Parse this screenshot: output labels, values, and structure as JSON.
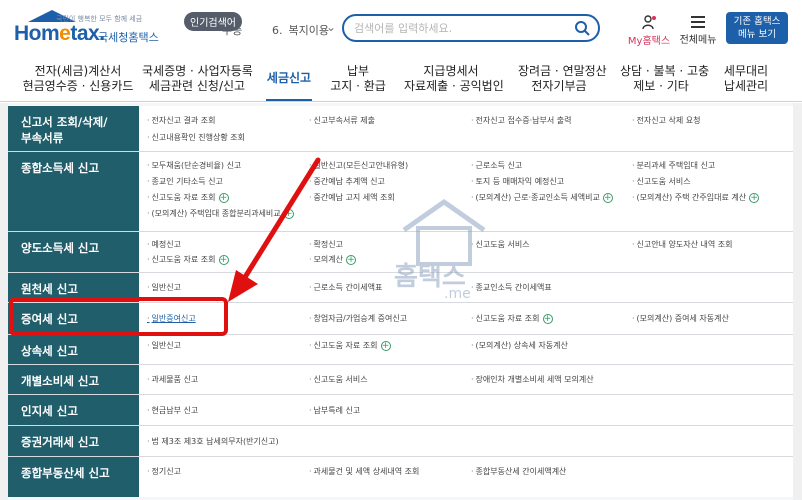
{
  "header": {
    "logo_slogan": "국민이 행복한 모두 함께 세금",
    "logo_brand_a": "Hom",
    "logo_brand_b": "e",
    "logo_brand_c": "tax.",
    "logo_sub": "국세청홈택스",
    "popular_tag": "인기검색어",
    "popular_prev": "수증",
    "popular_rank_num": "6.",
    "popular_rank_text": "복지이용",
    "search_placeholder": "검색어를 입력하세요.",
    "my_label": "My홈택스",
    "menu_label": "전체메뉴",
    "legacy_line1": "기존 홈택스",
    "legacy_line2": "메뉴 보기"
  },
  "gnb": [
    {
      "line1": "전자(세금)계산서",
      "line2": "현금영수증 · 신용카드"
    },
    {
      "line1": "국세증명 · 사업자등록",
      "line2": "세금관련 신청/신고"
    },
    {
      "line1": "세금신고",
      "line2": ""
    },
    {
      "line1": "납부",
      "line2": "고지 · 환급"
    },
    {
      "line1": "지급명세서",
      "line2": "자료제출 · 공익법인"
    },
    {
      "line1": "장려금 · 연말정산",
      "line2": "전자기부금"
    },
    {
      "line1": "상담 · 불복 · 고충",
      "line2": "제보 · 기타"
    },
    {
      "line1": "세무대리",
      "line2": "납세관리"
    }
  ],
  "rows": [
    {
      "head_line1": "신고서 조회/삭제/",
      "head_line2": "부속서류",
      "items": [
        "전자신고 결과 조회",
        "신고부속서류 제출",
        "전자신고 접수증·납부서 출력",
        "전자신고 삭제 요청",
        "신고내용확인 진행상황 조회"
      ]
    },
    {
      "head_line1": "종합소득세 신고",
      "head_line2": "",
      "items": [
        "모두채움(단순경비율) 신고",
        "일반신고(모든신고안내유형)",
        "근로소득 신고",
        "분리과세 주택임대 신고",
        "종교인 기타소득 신고",
        "중간예납 추계액 신고",
        "토지 등 매매차익 예정신고",
        "신고도움 서비스",
        "신고도움 자료 조회",
        "중간예납 고지 세액 조회",
        "(모의계산) 근로·종교인소득 세액비교",
        "(모의계산) 주택 간주임대료 계산",
        "(모의계산) 주택임대 종합분리과세비교"
      ]
    },
    {
      "head_line1": "양도소득세 신고",
      "head_line2": "",
      "items": [
        "예정신고",
        "확정신고",
        "신고도움 서비스",
        "신고안내 양도자산 내역 조회",
        "신고도움 자료 조회",
        "모의계산"
      ]
    },
    {
      "head_line1": "원천세 신고",
      "head_line2": "",
      "items": [
        "일반신고",
        "근로소득 간이세액표",
        "종교인소득 간이세액표"
      ]
    },
    {
      "head_line1": "증여세 신고",
      "head_line2": "",
      "items": [
        "일반증여신고",
        "창업자금/가업승계 증여신고",
        "신고도움 자료 조회",
        "(모의계산) 증여세 자동계산"
      ]
    },
    {
      "head_line1": "상속세 신고",
      "head_line2": "",
      "items": [
        "일반신고",
        "신고도움 자료 조회",
        "(모의계산) 상속세 자동계산"
      ]
    },
    {
      "head_line1": "개별소비세 신고",
      "head_line2": "",
      "items": [
        "과세물품 신고",
        "신고도움 서비스",
        "장애인차 개별소비세 세액 모의계산"
      ]
    },
    {
      "head_line1": "인지세 신고",
      "head_line2": "",
      "items": [
        "현금납부 신고",
        "납부특례 신고"
      ]
    },
    {
      "head_line1": "증권거래세 신고",
      "head_line2": "",
      "items": [
        "법 제3조 제3호 납세의무자(반기신고)"
      ]
    },
    {
      "head_line1": "종합부동산세 신고",
      "head_line2": "",
      "items": [
        "정기신고",
        "과세물건 및 세액 상세내역 조회",
        "종합부동산세 간이세액계산"
      ]
    }
  ],
  "watermark": {
    "text": "홈택스",
    "sub": ".me"
  },
  "colors": {
    "brand": "#1d5fa8",
    "row_head": "#215e6b",
    "highlight": "#e01010",
    "plus": "#3a9a6a"
  }
}
